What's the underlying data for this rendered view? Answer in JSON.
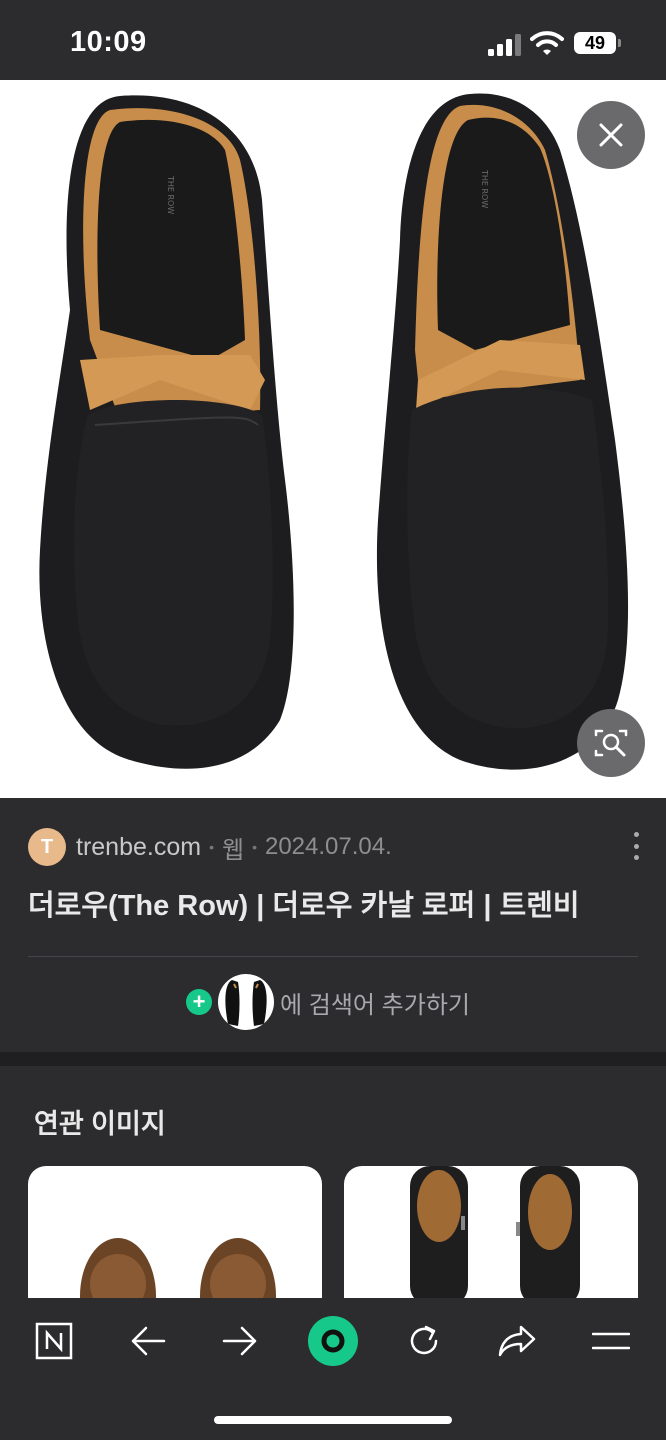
{
  "status_bar": {
    "time": "10:09",
    "battery_level": "49",
    "icons": [
      "signal-icon",
      "wifi-icon",
      "battery-icon"
    ]
  },
  "image_viewer": {
    "image_subject": "black leather loafers",
    "image_text": "THE ROW",
    "close_icon": "close-icon",
    "lens_icon": "image-search-icon"
  },
  "result": {
    "favicon_letter": "T",
    "domain": "trenbe.com",
    "type": "웹",
    "date": "2024.07.04.",
    "title": "더로우(The Row) | 더로우 카날 로퍼 | 트렌비",
    "add_search_label": "에 검색어 추가하기"
  },
  "related": {
    "heading": "연관 이미지"
  },
  "toolbar": {
    "items": [
      "naver-home-icon",
      "back-arrow-icon",
      "forward-arrow-icon",
      "green-dot-icon",
      "reload-icon",
      "share-icon",
      "menu-icon"
    ]
  },
  "colors": {
    "background": "#2c2c2e",
    "accent_green": "#16c98a",
    "favicon_bg": "#e8b98a"
  }
}
